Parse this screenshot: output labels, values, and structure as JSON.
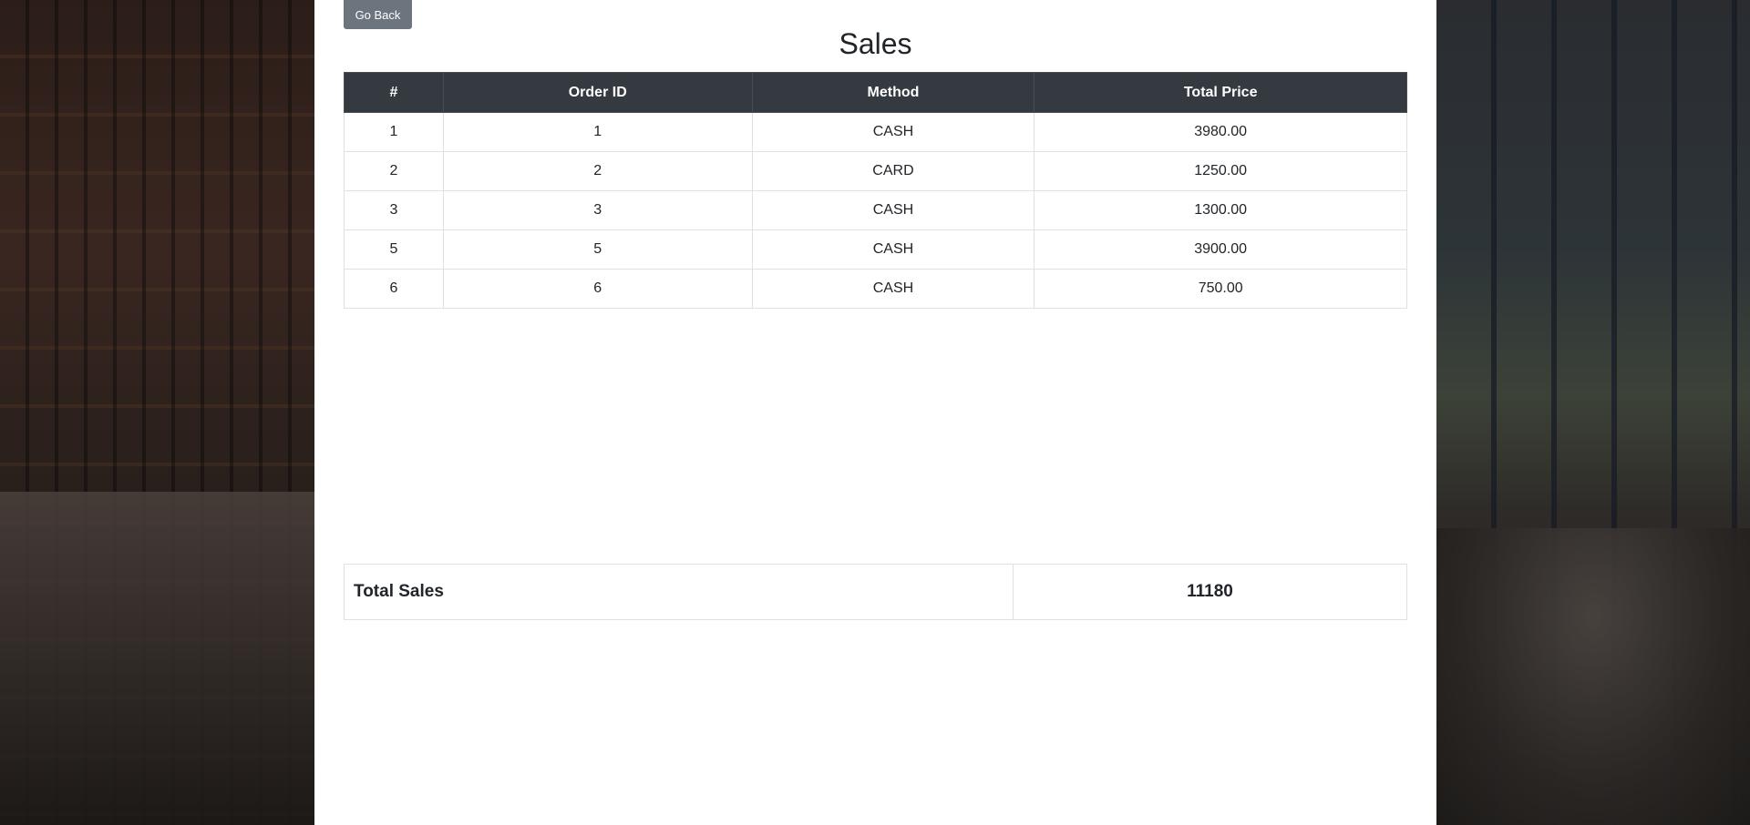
{
  "header": {
    "back_label": "Go Back",
    "title": "Sales"
  },
  "sales_table": {
    "columns": [
      "#",
      "Order ID",
      "Method",
      "Total Price"
    ],
    "rows": [
      [
        "1",
        "1",
        "CASH",
        "3980.00"
      ],
      [
        "2",
        "2",
        "CARD",
        "1250.00"
      ],
      [
        "3",
        "3",
        "CASH",
        "1300.00"
      ],
      [
        "5",
        "5",
        "CASH",
        "3900.00"
      ],
      [
        "6",
        "6",
        "CASH",
        "750.00"
      ]
    ]
  },
  "summary": {
    "label": "Total Sales",
    "value": "11180"
  },
  "colors": {
    "header_bg": "#343a40",
    "button_bg": "#6c757d",
    "panel_bg": "#ffffff"
  }
}
